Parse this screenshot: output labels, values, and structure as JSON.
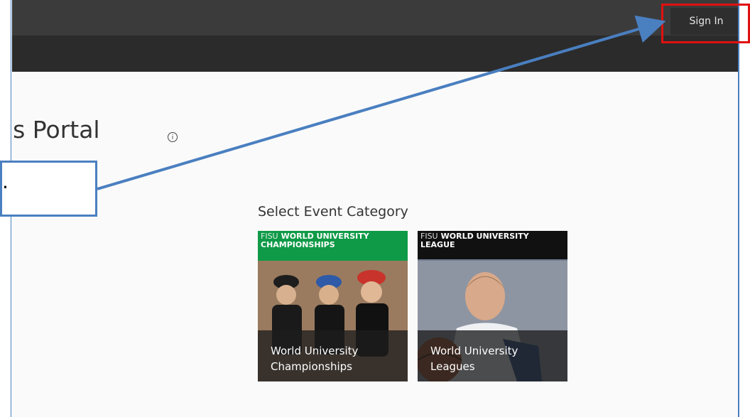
{
  "header": {
    "signin_label": "Sign In"
  },
  "page": {
    "title": "ons Portal",
    "info_icon": "info-icon",
    "select_heading": "Select Event Category"
  },
  "tiles": [
    {
      "banner_prefix": "FISU",
      "banner_line1": "WORLD UNIVERSITY",
      "banner_line2": "CHAMPIONSHIPS",
      "caption_line1": "World University",
      "caption_line2": "Championships",
      "color": "#0f9a47"
    },
    {
      "banner_prefix": "FISU",
      "banner_line1": "WORLD UNIVERSITY",
      "banner_line2": "LEAGUE",
      "caption_line1": "World University",
      "caption_line2": "Leagues",
      "color": "#111111"
    }
  ],
  "annotation": {
    "callout_text": ".",
    "arrow_color": "#4a7fc0",
    "highlight_color": "#e01010"
  }
}
